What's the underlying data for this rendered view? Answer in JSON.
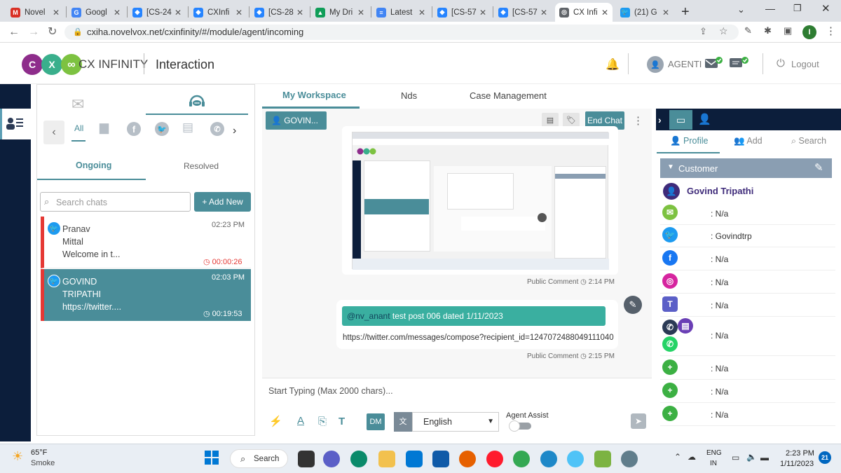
{
  "browser": {
    "tabs": [
      {
        "label": "Novel",
        "color": "#d93025",
        "glyph": "M"
      },
      {
        "label": "Googl",
        "color": "#4285f4",
        "glyph": "G"
      },
      {
        "label": "[CS-24",
        "color": "#2684ff",
        "glyph": "◆"
      },
      {
        "label": "CXInfi",
        "color": "#2684ff",
        "glyph": "◆"
      },
      {
        "label": "[CS-28",
        "color": "#2684ff",
        "glyph": "◆"
      },
      {
        "label": "My Dri",
        "color": "#0f9d58",
        "glyph": "▲"
      },
      {
        "label": "Latest",
        "color": "#4285f4",
        "glyph": "≡"
      },
      {
        "label": "[CS-57",
        "color": "#2684ff",
        "glyph": "◆"
      },
      {
        "label": "[CS-57",
        "color": "#2684ff",
        "glyph": "◆"
      },
      {
        "label": "CX Infi",
        "color": "#5f6368",
        "glyph": "◎"
      },
      {
        "label": "(21) G",
        "color": "#1d9bf0",
        "glyph": "🐦"
      }
    ],
    "url": "cxiha.novelvox.net/cxinfinity/#/module/agent/incoming",
    "profile_initial": "I"
  },
  "header": {
    "logo_text": "CX INFINITY",
    "page_title": "Interaction",
    "agent_name": "AGENTI",
    "logout_label": "Logout"
  },
  "chatpanel": {
    "channel_all": "All",
    "tab_ongoing": "Ongoing",
    "tab_resolved": "Resolved",
    "search_placeholder": "Search chats",
    "add_new": "+ Add New",
    "chats": [
      {
        "first": "Pranav",
        "second": "Mittal",
        "preview": "Welcome in t...",
        "time": "02:23 PM",
        "timer": "00:00:26"
      },
      {
        "first": "GOVIND",
        "second": "TRIPATHI",
        "preview": "https://twitter....",
        "time": "02:03 PM",
        "timer": "00:19:53"
      }
    ]
  },
  "workspace": {
    "tabs": [
      "My Workspace",
      "Nds",
      "Case Management"
    ],
    "contact_chip": "GOVIN...",
    "end_chat": "End Chat",
    "messages": [
      {
        "meta": "Public Comment",
        "time": "2:14 PM"
      },
      {
        "handle": "@nv_anant",
        "text": "test post 006 dated 1/11/2023",
        "link": "https://twitter.com/messages/compose?recipient_id=1247072488049111040",
        "meta": "Public Comment",
        "time": "2:15 PM"
      }
    ],
    "composer_placeholder": "Start Typing (Max 2000 chars)...",
    "dm_label": "DM",
    "language": "English",
    "agent_assist": "Agent Assist"
  },
  "rightpanel": {
    "tabs": [
      "Profile",
      "Add",
      "Search"
    ],
    "section": "Customer",
    "customer_name": "Govind Tripathi",
    "rows": [
      {
        "icon": "email-icon",
        "color": "#7dc241",
        "value": ": N/a"
      },
      {
        "icon": "twitter-icon",
        "color": "#1d9bf0",
        "value": ": Govindtrp"
      },
      {
        "icon": "facebook-icon",
        "color": "#1877f2",
        "value": ": N/a"
      },
      {
        "icon": "instagram-icon",
        "color": "#d6249f",
        "value": ": N/a"
      },
      {
        "icon": "teams-icon",
        "color": "#5b5fc7",
        "value": ": N/a"
      },
      {
        "icon": "phone-whatsapp-icon",
        "color": "#25d366",
        "value": ": N/a"
      },
      {
        "icon": "add-icon",
        "color": "#3cb043",
        "value": ": N/a"
      },
      {
        "icon": "add-icon",
        "color": "#3cb043",
        "value": ": N/a"
      },
      {
        "icon": "add-icon",
        "color": "#3cb043",
        "value": ": N/a"
      }
    ]
  },
  "taskbar": {
    "weather_temp": "65°F",
    "weather_desc": "Smoke",
    "search": "Search",
    "lang1": "ENG",
    "lang2": "IN",
    "time": "2:23 PM",
    "date": "1/11/2023",
    "notif_count": "21"
  },
  "colors": {
    "teal": "#4a8d99",
    "navy": "#0c1e3b",
    "red": "#e53935",
    "green": "#3aafa0"
  }
}
